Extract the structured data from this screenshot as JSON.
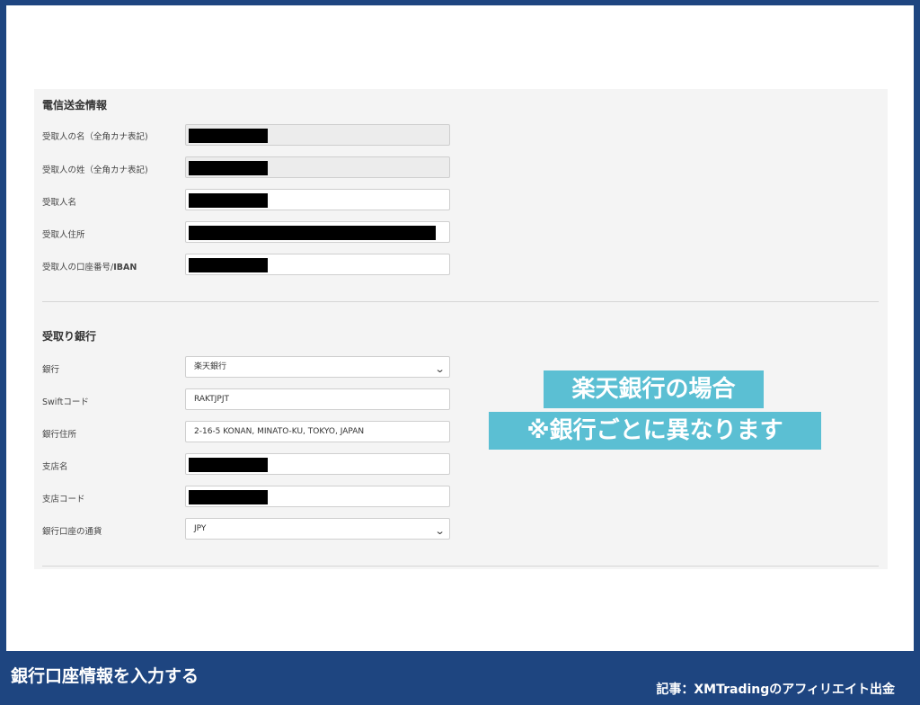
{
  "wire_section": {
    "title": "電信送金情報",
    "rows": [
      {
        "label": "受取人の名（全角カナ表記)",
        "value": ""
      },
      {
        "label": "受取人の姓（全角カナ表記)",
        "value": ""
      },
      {
        "label": "受取人名",
        "value": ""
      },
      {
        "label": "受取人住所",
        "value": ""
      },
      {
        "label_prefix": "受取人の口座番号/",
        "label_bold": "IBAN",
        "value": ""
      }
    ]
  },
  "bank_section": {
    "title": "受取り銀行",
    "rows": [
      {
        "label": "銀行",
        "value": "楽天銀行"
      },
      {
        "label": "Swiftコード",
        "value": "RAKTJPJT"
      },
      {
        "label": "銀行住所",
        "value": "2-16-5 KONAN, MINATO-KU, TOKYO, JAPAN"
      },
      {
        "label": "支店名",
        "value": ""
      },
      {
        "label": "支店コード",
        "value": ""
      },
      {
        "label": "銀行口座の通貨",
        "value": "JPY"
      }
    ]
  },
  "callout": {
    "line1": "楽天銀行の場合",
    "line2": "※銀行ごとに異なります"
  },
  "footer": {
    "left": "銀行口座情報を入力する",
    "right": "記事：XMTradingのアフィリエイト出金"
  },
  "colors": {
    "frame": "#1e4580",
    "callout": "#5bbfd3",
    "panel": "#f4f4f4"
  },
  "icons": {
    "select_arrow": "chevron-down-icon",
    "redaction": "black-redaction-bar"
  }
}
